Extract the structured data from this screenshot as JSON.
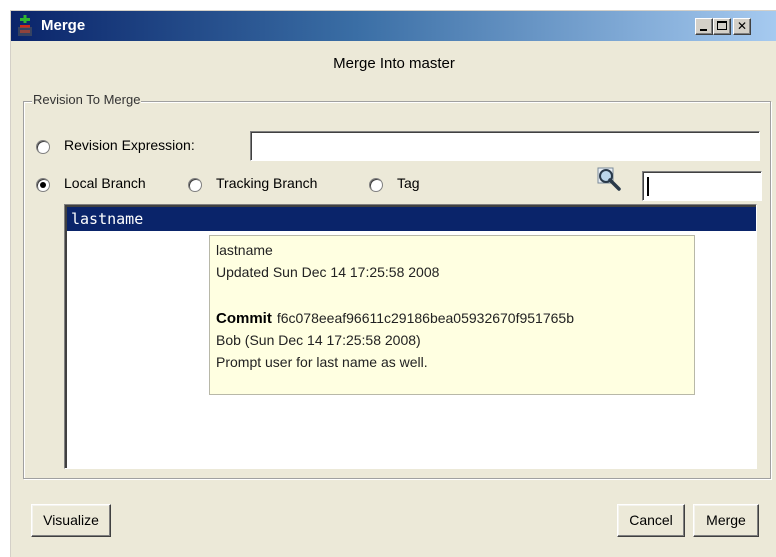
{
  "window": {
    "title": "Merge",
    "controls": {
      "minimize": "minimize",
      "maximize": "maximize",
      "close": "close"
    }
  },
  "header": {
    "title": "Merge Into master"
  },
  "revision_group": {
    "legend": "Revision To Merge",
    "options": [
      {
        "label": "Revision Expression:",
        "selected": false
      },
      {
        "label": "Local Branch",
        "selected": true
      },
      {
        "label": "Tracking Branch",
        "selected": false
      },
      {
        "label": "Tag",
        "selected": false
      }
    ],
    "revision_expression_value": "",
    "filter_value": "",
    "filter_icon": "search-icon"
  },
  "branches": [
    {
      "name": "lastname",
      "selected": true
    }
  ],
  "tooltip": {
    "name": "lastname",
    "updated": "Updated Sun Dec 14 17:25:58 2008",
    "commit_label": "Commit",
    "commit_hash": "f6c078eeaf96611c29186bea05932670f951765b",
    "author": "Bob (Sun Dec 14 17:25:58 2008)",
    "message": "Prompt user for last name as well."
  },
  "buttons": {
    "visualize": "Visualize",
    "cancel": "Cancel",
    "merge": "Merge"
  },
  "colors": {
    "titlebar_start": "#0a246a",
    "titlebar_end": "#a6caf0",
    "selection": "#0a246a",
    "tooltip_bg": "#ffffe1",
    "dialog_bg": "#ece9d8"
  }
}
